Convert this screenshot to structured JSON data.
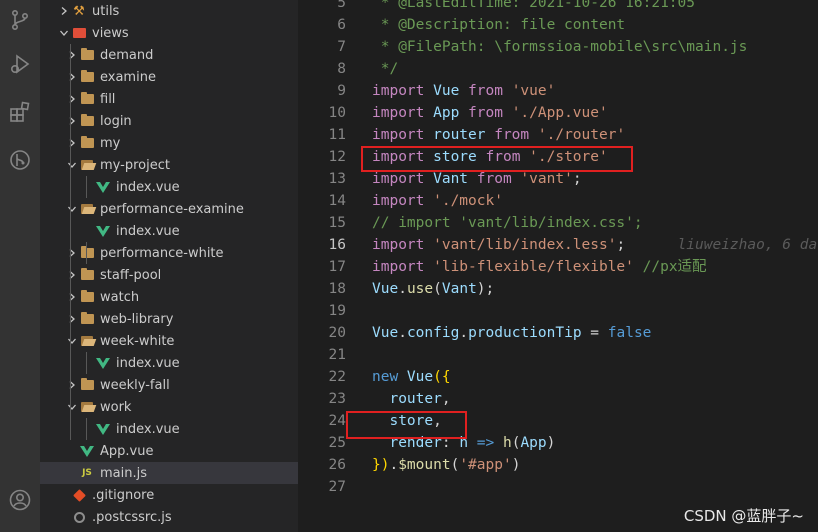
{
  "activity_bar": {
    "icons": [
      "source-control-icon",
      "run-debug-icon",
      "extensions-icon",
      "git-graph-icon",
      "account-icon"
    ]
  },
  "explorer": {
    "items": [
      {
        "label": "utils",
        "type": "folder",
        "depth": 1,
        "expanded": false
      },
      {
        "label": "views",
        "type": "folder",
        "depth": 1,
        "expanded": true
      },
      {
        "label": "demand",
        "type": "folder",
        "depth": 2,
        "expanded": false
      },
      {
        "label": "examine",
        "type": "folder",
        "depth": 2,
        "expanded": false
      },
      {
        "label": "fill",
        "type": "folder",
        "depth": 2,
        "expanded": false
      },
      {
        "label": "login",
        "type": "folder",
        "depth": 2,
        "expanded": false
      },
      {
        "label": "my",
        "type": "folder",
        "depth": 2,
        "expanded": false
      },
      {
        "label": "my-project",
        "type": "folder",
        "depth": 2,
        "expanded": true
      },
      {
        "label": "index.vue",
        "type": "vue",
        "depth": 3
      },
      {
        "label": "performance-examine",
        "type": "folder",
        "depth": 2,
        "expanded": true
      },
      {
        "label": "index.vue",
        "type": "vue",
        "depth": 3
      },
      {
        "label": "performance-white",
        "type": "folder",
        "depth": 2,
        "expanded": false
      },
      {
        "label": "staff-pool",
        "type": "folder",
        "depth": 2,
        "expanded": false
      },
      {
        "label": "watch",
        "type": "folder",
        "depth": 2,
        "expanded": false
      },
      {
        "label": "web-library",
        "type": "folder",
        "depth": 2,
        "expanded": false
      },
      {
        "label": "week-white",
        "type": "folder",
        "depth": 2,
        "expanded": true
      },
      {
        "label": "index.vue",
        "type": "vue",
        "depth": 3
      },
      {
        "label": "weekly-fall",
        "type": "folder",
        "depth": 2,
        "expanded": false
      },
      {
        "label": "work",
        "type": "folder",
        "depth": 2,
        "expanded": true
      },
      {
        "label": "index.vue",
        "type": "vue",
        "depth": 3
      },
      {
        "label": "App.vue",
        "type": "vue",
        "depth": 1
      },
      {
        "label": "main.js",
        "type": "js",
        "depth": 1,
        "selected": true
      },
      {
        "label": ".gitignore",
        "type": "git",
        "depth": 0
      },
      {
        "label": ".postcssrc.js",
        "type": "config",
        "depth": 0
      }
    ]
  },
  "editor": {
    "active_line": "16",
    "lines": [
      {
        "num": "5",
        "tokens": [
          {
            "t": " * @LastEditTime: 2021-10-26 16:21:05",
            "c": "cmt"
          }
        ]
      },
      {
        "num": "6",
        "tokens": [
          {
            "t": " * @Description: file content",
            "c": "cmt"
          }
        ]
      },
      {
        "num": "7",
        "tokens": [
          {
            "t": " * @FilePath: \\formssioa-mobile\\src\\main.js",
            "c": "cmt"
          }
        ]
      },
      {
        "num": "8",
        "tokens": [
          {
            "t": " */",
            "c": "cmt"
          }
        ]
      },
      {
        "num": "9",
        "tokens": [
          {
            "t": "import ",
            "c": "kw"
          },
          {
            "t": "Vue ",
            "c": "var"
          },
          {
            "t": "from ",
            "c": "kw"
          },
          {
            "t": "'vue'",
            "c": "str"
          }
        ]
      },
      {
        "num": "10",
        "tokens": [
          {
            "t": "import ",
            "c": "kw"
          },
          {
            "t": "App ",
            "c": "var"
          },
          {
            "t": "from ",
            "c": "kw"
          },
          {
            "t": "'./App.vue'",
            "c": "str"
          }
        ]
      },
      {
        "num": "11",
        "tokens": [
          {
            "t": "import ",
            "c": "kw"
          },
          {
            "t": "router ",
            "c": "var"
          },
          {
            "t": "from ",
            "c": "kw"
          },
          {
            "t": "'./router'",
            "c": "str"
          }
        ]
      },
      {
        "num": "12",
        "tokens": [
          {
            "t": "import ",
            "c": "kw"
          },
          {
            "t": "store ",
            "c": "var"
          },
          {
            "t": "from ",
            "c": "kw"
          },
          {
            "t": "'./store'",
            "c": "str"
          }
        ]
      },
      {
        "num": "13",
        "tokens": [
          {
            "t": "import ",
            "c": "kw"
          },
          {
            "t": "Vant ",
            "c": "var"
          },
          {
            "t": "from ",
            "c": "kw"
          },
          {
            "t": "'vant'",
            "c": "str"
          },
          {
            "t": ";",
            "c": "pl"
          }
        ]
      },
      {
        "num": "14",
        "tokens": [
          {
            "t": "import ",
            "c": "kw"
          },
          {
            "t": "'./mock'",
            "c": "str"
          }
        ]
      },
      {
        "num": "15",
        "tokens": [
          {
            "t": "// import 'vant/lib/index.css';",
            "c": "cmt"
          }
        ]
      },
      {
        "num": "16",
        "tokens": [
          {
            "t": "import ",
            "c": "kw"
          },
          {
            "t": "'vant/lib/index.less'",
            "c": "str"
          },
          {
            "t": ";",
            "c": "pl"
          },
          {
            "t": "      liuweizhao, 6 da",
            "c": "blame"
          }
        ]
      },
      {
        "num": "17",
        "tokens": [
          {
            "t": "import ",
            "c": "kw"
          },
          {
            "t": "'lib-flexible/flexible'",
            "c": "str"
          },
          {
            "t": " //px适配",
            "c": "cmt"
          }
        ]
      },
      {
        "num": "18",
        "tokens": [
          {
            "t": "Vue",
            "c": "var"
          },
          {
            "t": ".",
            "c": "pl"
          },
          {
            "t": "use",
            "c": "fn"
          },
          {
            "t": "(",
            "c": "pl"
          },
          {
            "t": "Vant",
            "c": "var"
          },
          {
            "t": ");",
            "c": "pl"
          }
        ]
      },
      {
        "num": "19",
        "tokens": []
      },
      {
        "num": "20",
        "tokens": [
          {
            "t": "Vue",
            "c": "var"
          },
          {
            "t": ".",
            "c": "pl"
          },
          {
            "t": "config",
            "c": "var"
          },
          {
            "t": ".",
            "c": "pl"
          },
          {
            "t": "productionTip",
            "c": "var"
          },
          {
            "t": " = ",
            "c": "pl"
          },
          {
            "t": "false",
            "c": "bool"
          }
        ]
      },
      {
        "num": "21",
        "tokens": []
      },
      {
        "num": "22",
        "tokens": [
          {
            "t": "new ",
            "c": "bool"
          },
          {
            "t": "Vue",
            "c": "var"
          },
          {
            "t": "({",
            "c": "br"
          }
        ]
      },
      {
        "num": "23",
        "tokens": [
          {
            "t": "  router",
            "c": "var"
          },
          {
            "t": ",",
            "c": "pl"
          }
        ]
      },
      {
        "num": "24",
        "tokens": [
          {
            "t": "  store",
            "c": "var"
          },
          {
            "t": ",",
            "c": "pl"
          }
        ]
      },
      {
        "num": "25",
        "tokens": [
          {
            "t": "  render",
            "c": "var"
          },
          {
            "t": ": ",
            "c": "pl"
          },
          {
            "t": "h",
            "c": "var"
          },
          {
            "t": " => ",
            "c": "bool"
          },
          {
            "t": "h",
            "c": "fn"
          },
          {
            "t": "(",
            "c": "pl"
          },
          {
            "t": "App",
            "c": "var"
          },
          {
            "t": ")",
            "c": "pl"
          }
        ]
      },
      {
        "num": "26",
        "tokens": [
          {
            "t": "})",
            "c": "br"
          },
          {
            "t": ".",
            "c": "pl"
          },
          {
            "t": "$mount",
            "c": "fn"
          },
          {
            "t": "(",
            "c": "pl"
          },
          {
            "t": "'#app'",
            "c": "str"
          },
          {
            "t": ")",
            "c": "pl"
          }
        ]
      },
      {
        "num": "27",
        "tokens": []
      }
    ]
  },
  "watermark": "CSDN @蓝胖子~",
  "colors": {
    "highlight_box": "#e02020",
    "selected_row": "#37373d",
    "sidebar_bg": "#252526",
    "editor_bg": "#1e1e1e"
  }
}
